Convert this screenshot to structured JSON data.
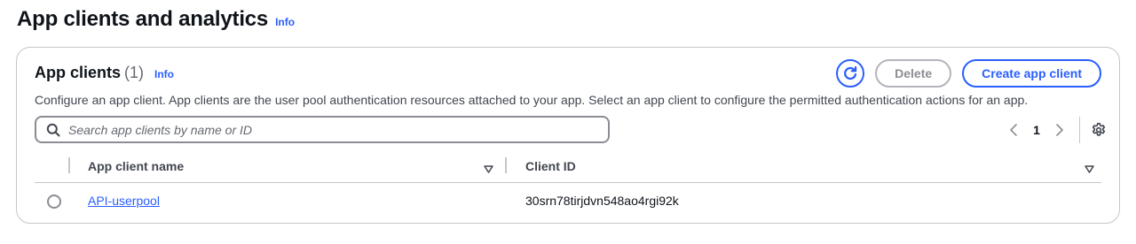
{
  "page": {
    "title": "App clients and analytics",
    "info_label": "Info"
  },
  "app_clients": {
    "title": "App clients",
    "count": "(1)",
    "info_label": "Info",
    "description": "Configure an app client. App clients are the user pool authentication resources attached to your app. Select an app client to configure the permitted authentication actions for an app.",
    "actions": {
      "refresh_icon": "refresh-icon",
      "delete_label": "Delete",
      "delete_disabled": true,
      "create_label": "Create app client"
    },
    "search": {
      "placeholder": "Search app clients by name or ID",
      "value": "",
      "icon": "search-icon"
    },
    "pagination": {
      "current_page": "1",
      "prev_icon": "chevron-left-icon",
      "next_icon": "chevron-right-icon",
      "settings_icon": "gear-icon"
    },
    "table": {
      "columns": [
        "App client name",
        "Client ID"
      ],
      "rows": [
        {
          "app_client_name": "API-userpool",
          "client_id": "30srn78tirjdvn548ao4rgi92k",
          "selected": false
        }
      ]
    }
  },
  "colors": {
    "accent": "#295eff",
    "text": "#0f141a",
    "secondary_text": "#424650",
    "border": "#c6c6cd",
    "disabled": "#8c8c94"
  }
}
